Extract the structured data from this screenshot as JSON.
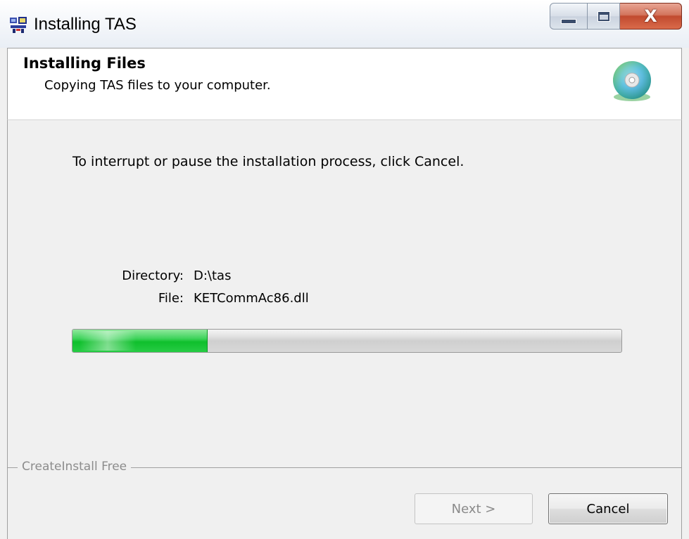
{
  "window": {
    "title": "Installing TAS",
    "close_glyph": "X"
  },
  "header": {
    "title": "Installing Files",
    "subtitle": "Copying TAS files to your computer.",
    "icon": "cd-disc-icon"
  },
  "body": {
    "instruction": "To interrupt or pause the installation process, click Cancel.",
    "directory_label": "Directory:",
    "directory_value": "D:\\tas",
    "file_label": "File:",
    "file_value": "KETCommAc86.dll"
  },
  "progress": {
    "fraction": 0.245,
    "color": "#0fbf2c"
  },
  "footer": {
    "group_label": "CreateInstall Free",
    "next_label": "Next >",
    "next_enabled": false,
    "cancel_label": "Cancel"
  },
  "colors": {
    "close_button": "#c14a2f",
    "window_bg": "#f0f0f0"
  }
}
